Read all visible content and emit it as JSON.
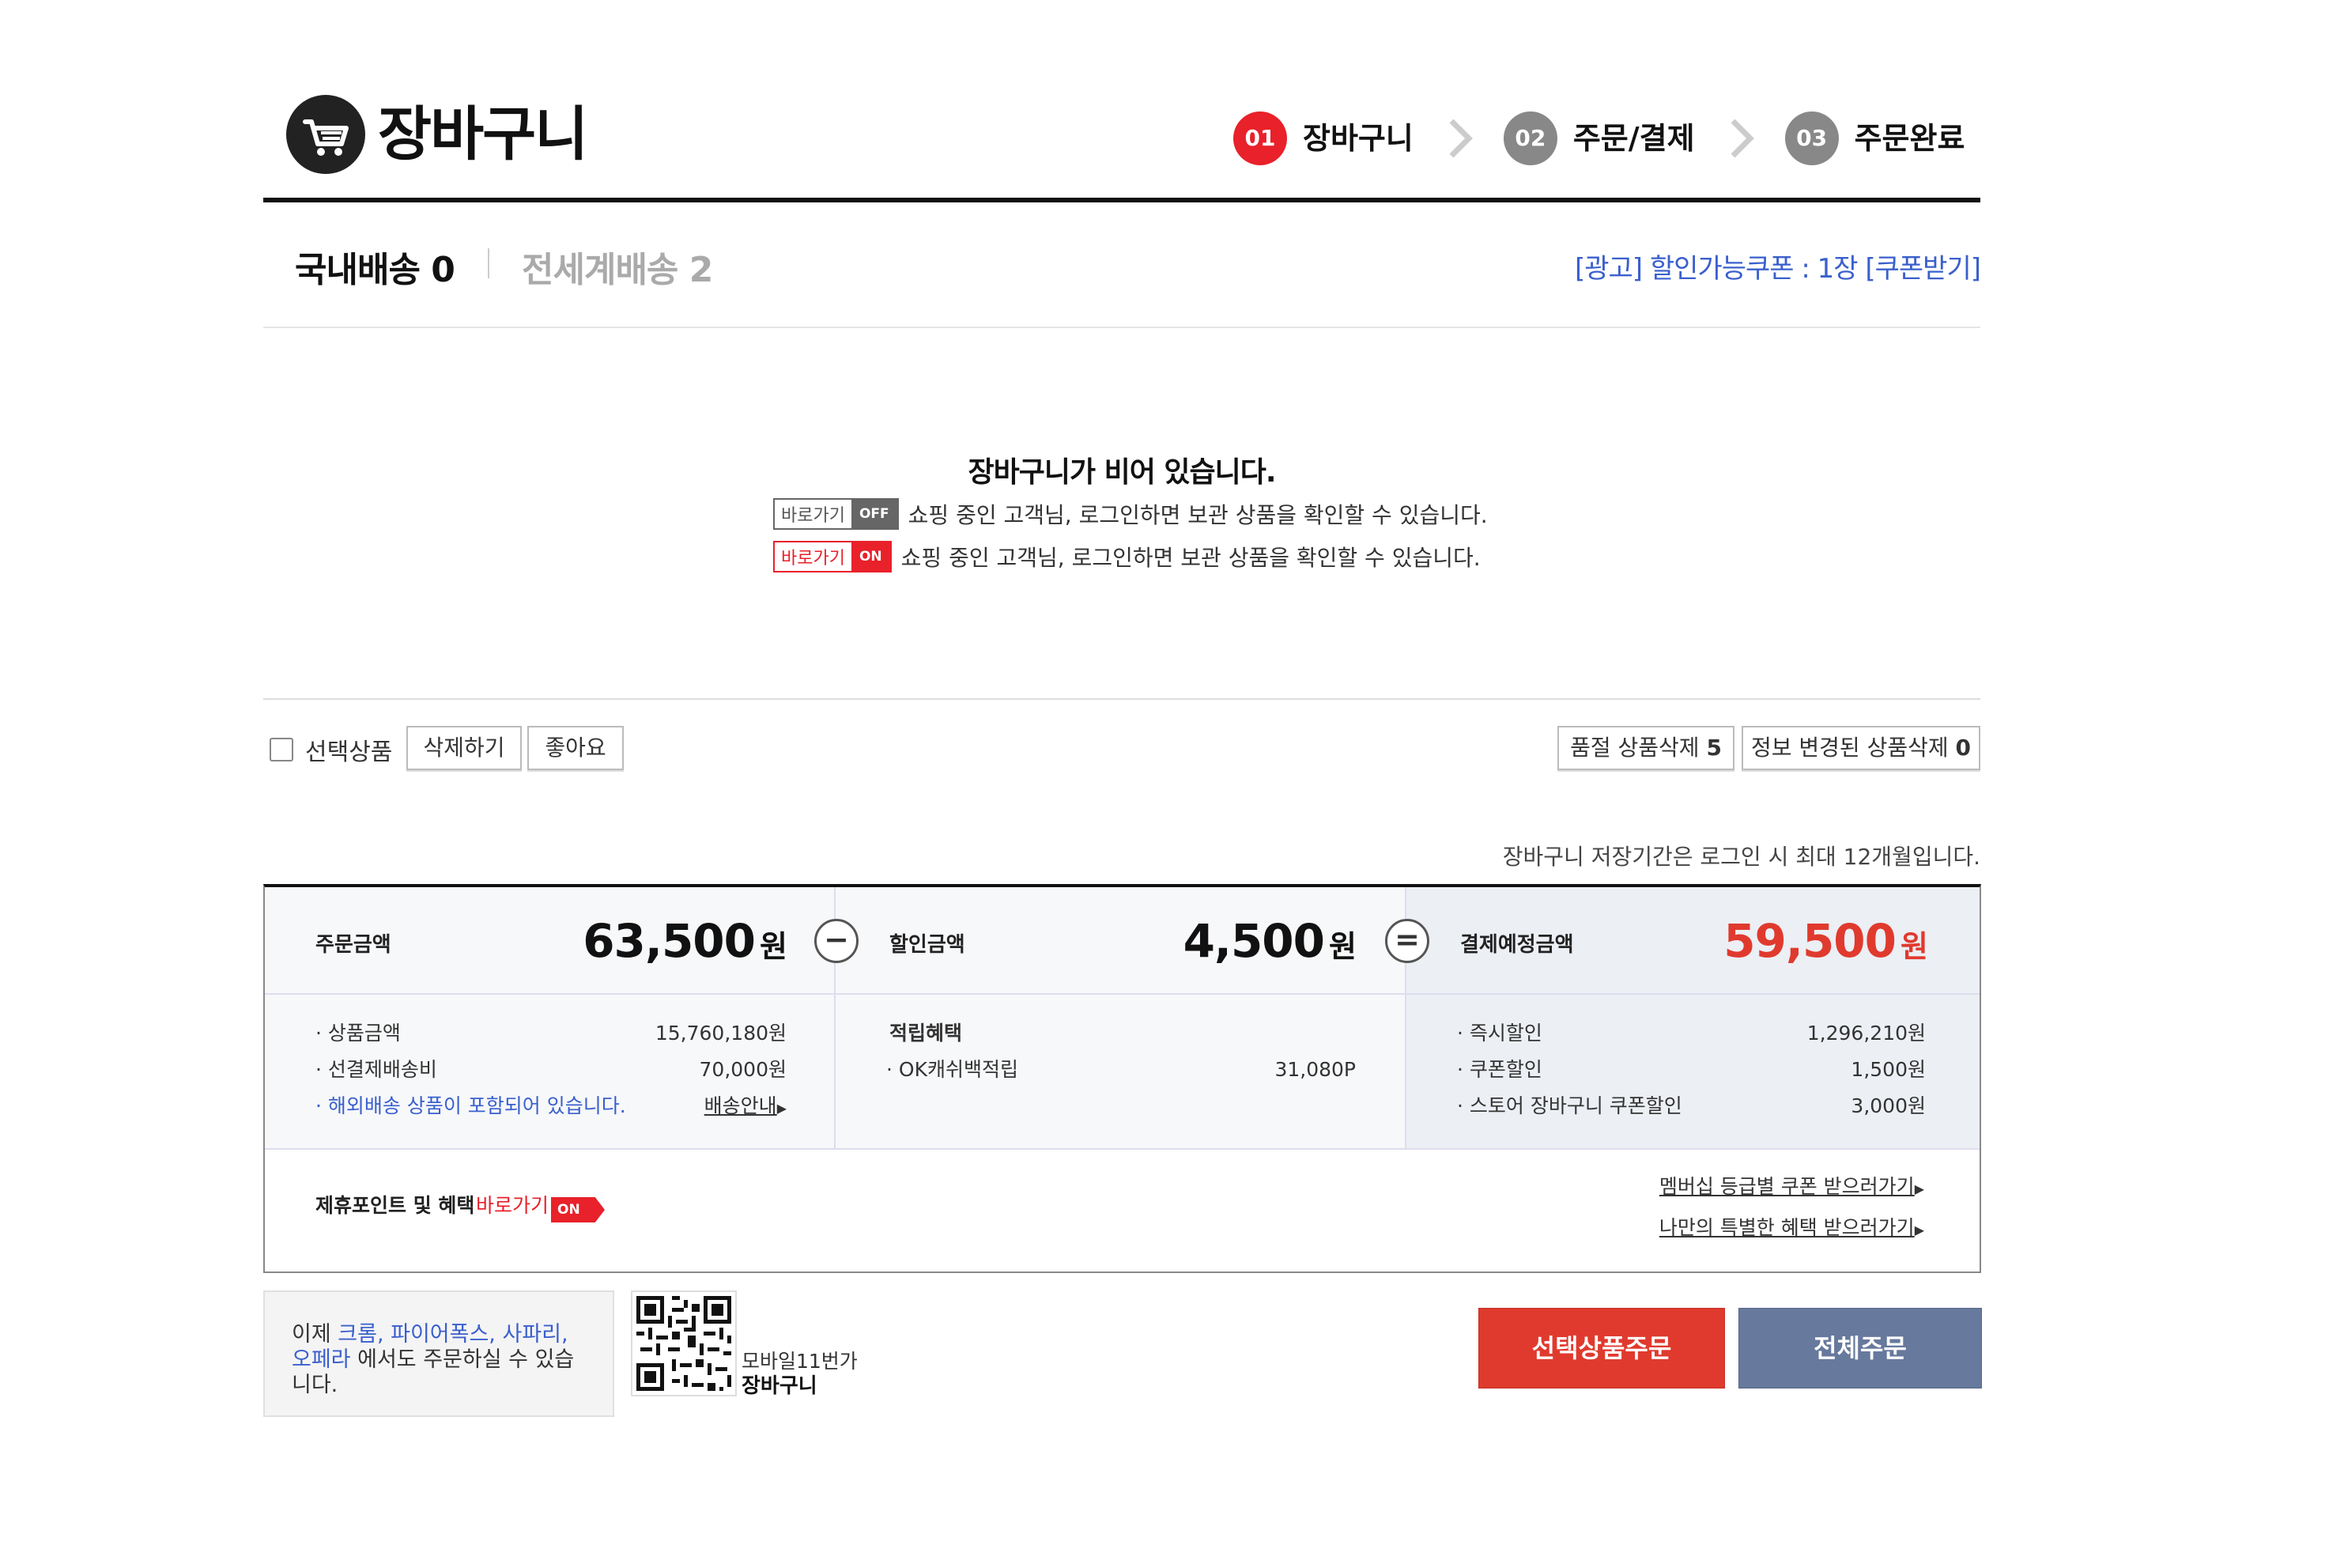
{
  "header": {
    "title": "장바구니",
    "steps": [
      {
        "num": "01",
        "label": "장바구니",
        "active": true
      },
      {
        "num": "02",
        "label": "주문/결제",
        "active": false
      },
      {
        "num": "03",
        "label": "주문완료",
        "active": false
      }
    ]
  },
  "tabs": {
    "domestic": "국내배송 0",
    "global": "전세계배송 2",
    "coupon_link": "[광고] 할인가능쿠폰 : 1장 [쿠폰받기]"
  },
  "empty": {
    "title": "장바구니가 비어 있습니다.",
    "rows": [
      {
        "badge_left": "바로가기",
        "badge_right": "OFF",
        "text": "쇼핑 중인 고객님, 로그인하면 보관 상품을 확인할 수 있습니다."
      },
      {
        "badge_left": "바로가기",
        "badge_right": "ON",
        "text": "쇼핑 중인 고객님, 로그인하면 보관 상품을 확인할 수 있습니다."
      }
    ]
  },
  "toolbar": {
    "select_label": "선택상품",
    "delete_label": "삭제하기",
    "like_label": "좋아요",
    "soldout_label": "품절 상품삭제",
    "soldout_count": "5",
    "changed_label": "정보 변경된 상품삭제",
    "changed_count": "0"
  },
  "storage_note": "장바구니 저장기간은 로그인 시 최대 12개월입니다.",
  "summary": {
    "order": {
      "label": "주문금액",
      "amount": "63,500",
      "unit": "원"
    },
    "discount": {
      "label": "할인금액",
      "amount": "4,500",
      "unit": "원"
    },
    "total": {
      "label": "결제예정금액",
      "amount": "59,500",
      "unit": "원"
    },
    "minus_symbol": "−",
    "equals_symbol": "=",
    "order_items": [
      {
        "label": "· 상품금액",
        "value": "15,760,180원"
      },
      {
        "label": "· 선결제배송비",
        "value": "70,000원"
      }
    ],
    "overseas_note": "· 해외배송 상품이 포함되어 있습니다.",
    "shipping_guide": "배송안내",
    "reward_title": "적립혜택",
    "reward_items": [
      {
        "label": "· OK캐쉬백적립",
        "value": "31,080P"
      }
    ],
    "discount_items": [
      {
        "label": "· 즉시할인",
        "value": "1,296,210원"
      },
      {
        "label": "· 쿠폰할인",
        "value": "1,500원"
      },
      {
        "label": "· 스토어 장바구니 쿠폰할인",
        "value": "3,000원"
      }
    ],
    "partner_label": "제휴포인트 및 혜택",
    "partner_link": "바로가기",
    "partner_badge": "ON",
    "membership_link": "멤버십 등급별 쿠폰 받으러가기",
    "special_link": "나만의 특별한 혜택 받으러가기"
  },
  "footer": {
    "text_prefix": "이제 ",
    "browsers": "크롬, 파이어폭스, 사파리, 오페라",
    "text_suffix": " 에서도 주문하실 수 있습니다.",
    "qr_caption1": "모바일11번가",
    "qr_caption2": "장바구니",
    "order_selected": "선택상품주문",
    "order_all": "전체주문"
  },
  "colors": {
    "accent_red": "#e03a2e",
    "order_all_bg": "#67799c",
    "link_blue": "#3a5fcd",
    "step_active": "#e8212a",
    "step_inactive": "#888888"
  }
}
